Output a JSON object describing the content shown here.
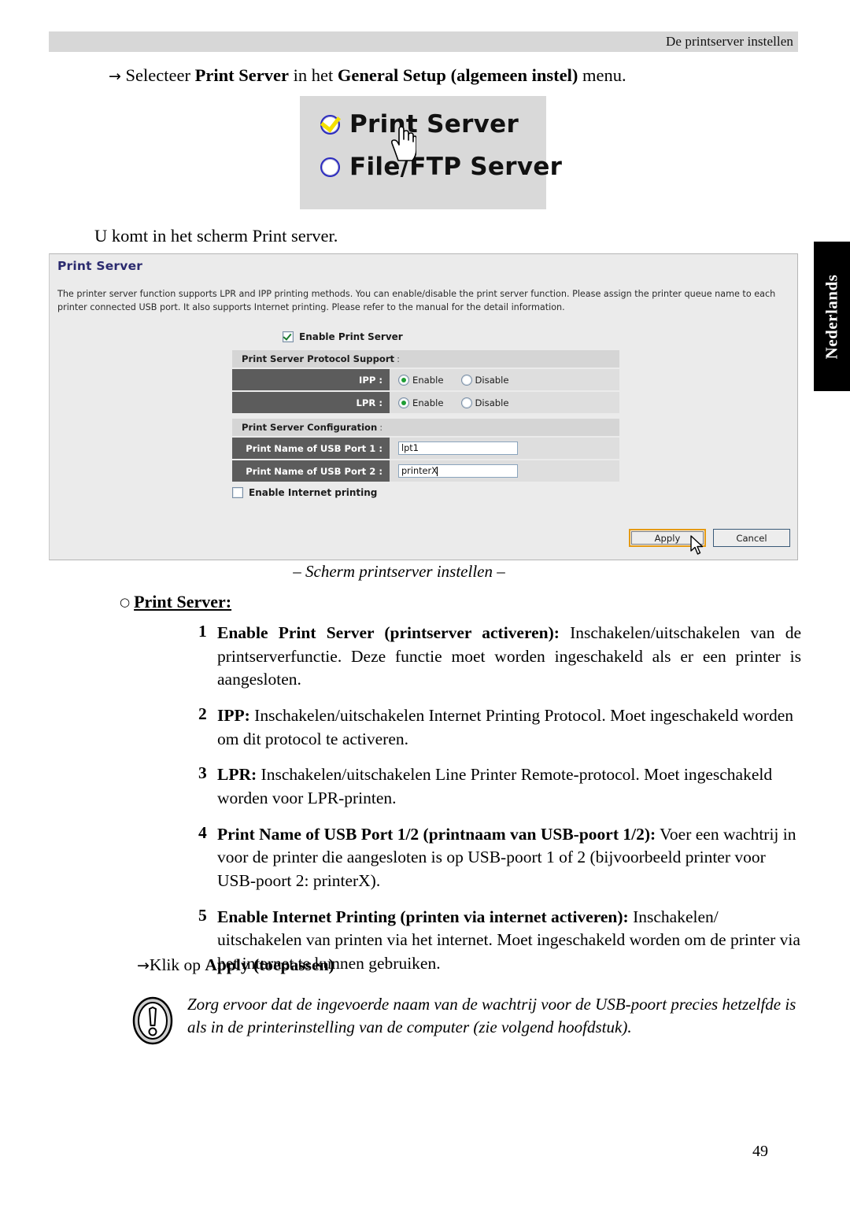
{
  "header": {
    "running_title": "De printserver instellen"
  },
  "intro": {
    "arrow": "→",
    "part1": "Selecteer ",
    "bold1": "Print Server",
    "part2": " in het ",
    "bold2": "General Setup (algemeen instel)",
    "part3": " menu."
  },
  "radio_figure": {
    "options": [
      {
        "label": "Print Server",
        "selected": true
      },
      {
        "label": "File/FTP Server",
        "selected": false
      }
    ],
    "cursor": "hand-cursor"
  },
  "lead": {
    "text": "U komt in het scherm Print server."
  },
  "ui": {
    "title": "Print Server",
    "description": "The printer server function supports LPR and IPP printing methods. You can enable/disable the print server function. Please assign the printer queue name to each printer connected USB port. It also supports Internet printing. Please refer to the manual for the detail information.",
    "enable_print_server": {
      "label": "Enable Print Server",
      "checked": true
    },
    "protocol_section": {
      "title": "Print Server Protocol Support",
      "colon": ":"
    },
    "protocol_rows": [
      {
        "label": "IPP :",
        "options": [
          {
            "label": "Enable",
            "selected": true
          },
          {
            "label": "Disable",
            "selected": false
          }
        ]
      },
      {
        "label": "LPR :",
        "options": [
          {
            "label": "Enable",
            "selected": true
          },
          {
            "label": "Disable",
            "selected": false
          }
        ]
      }
    ],
    "config_section": {
      "title": "Print Server Configuration",
      "colon": ":"
    },
    "config_rows": [
      {
        "label": "Print Name of USB Port 1 :",
        "value": "lpt1",
        "placeholder": "",
        "caret": false
      },
      {
        "label": "Print Name of USB Port 2 :",
        "value": "printerX",
        "placeholder": "",
        "caret": true
      }
    ],
    "enable_internet_printing": {
      "label": "Enable Internet printing",
      "checked": false
    },
    "buttons": {
      "apply": "Apply",
      "cancel": "Cancel"
    },
    "colors": {
      "panel_bg": "#ebebeb",
      "title_blue": "#2a2a6e",
      "label_gray": "#5c5c5c",
      "value_gray": "#dedede",
      "section_gray": "#d5d5d5",
      "focus_orange": "#e59a13",
      "radio_green": "#1f9e35",
      "check_green": "#1a7a2e"
    }
  },
  "caption": {
    "text": "– Scherm printserver instellen –"
  },
  "section": {
    "bullet": "○",
    "title": "Print Server:"
  },
  "list": [
    {
      "num": "1",
      "bold": "Enable Print Server (printserver activeren):",
      "text": " Inschakelen/uitschakelen van de printserverfunctie. Deze functie moet worden ingeschakeld als er een printer is aangesloten."
    },
    {
      "num": "2",
      "bold": "IPP:",
      "text": " Inschakelen/uitschakelen Internet Printing Protocol. Moet ingeschakeld worden om dit protocol te activeren."
    },
    {
      "num": "3",
      "bold": "LPR:",
      "text": " Inschakelen/uitschakelen Line Printer Remote-protocol. Moet ingeschakeld worden voor LPR-printen."
    },
    {
      "num": "4",
      "bold": "Print Name of USB Port 1/2 (printnaam van USB-poort 1/2):",
      "text": " Voer een wachtrij in voor de printer die aangesloten is op USB-poort 1 of 2 (bijvoorbeeld printer voor USB-poort 2: printerX)."
    },
    {
      "num": "5",
      "bold": "Enable Internet Printing (printen via internet activeren):",
      "text": " Inschakelen/ uitschakelen van printen via het internet. Moet ingeschakeld worden om de printer via het internet te kunnen gebruiken."
    }
  ],
  "klik": {
    "arrow": "→",
    "text": "Klik op ",
    "bold": "Apply (toepassen)"
  },
  "note": {
    "icon": "exclamation-icon",
    "text": "Zorg ervoor dat de ingevoerde naam van de wachtrij voor de USB-poort precies hetzelfde is als in de printerinstelling van de computer (zie volgend hoofdstuk)."
  },
  "language_tab": {
    "label": "Nederlands"
  },
  "page_number": "49"
}
